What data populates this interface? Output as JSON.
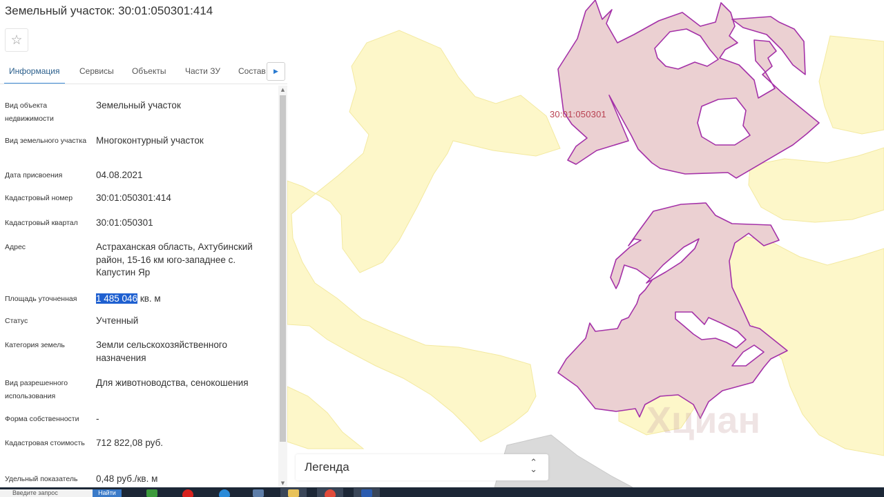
{
  "header": {
    "title": "Земельный участок: 30:01:050301:414",
    "favorite_icon": "star-outline-icon"
  },
  "tabs": [
    {
      "label": "Информация",
      "active": true
    },
    {
      "label": "Сервисы"
    },
    {
      "label": "Объекты"
    },
    {
      "label": "Части ЗУ"
    },
    {
      "label": "Состав"
    }
  ],
  "tab_next_icon": "arrow-right-icon",
  "attributes": [
    {
      "label": "Вид объекта недвижимости",
      "value": "Земельный участок"
    },
    {
      "label": "Вид земельного участка",
      "value": "Многоконтурный участок"
    },
    {
      "label": "Дата присвоения",
      "value": "04.08.2021"
    },
    {
      "label": "Кадастровый номер",
      "value": "30:01:050301:414"
    },
    {
      "label": "Кадастровый квартал",
      "value": "30:01:050301"
    },
    {
      "label": "Адрес",
      "value": "Астраханская область, Ахтубинский район, 15-16 км юго-западнее с. Капустин Яр"
    },
    {
      "label": "Площадь уточненная",
      "value_selected": "1 485 046",
      "value_rest": " кв. м"
    },
    {
      "label": "Статус",
      "value": "Учтенный"
    },
    {
      "label": "Категория земель",
      "value": "Земли сельскохозяйственного назначения"
    },
    {
      "label": "Вид разрешенного использования",
      "value": "Для животноводства, сенокошения"
    },
    {
      "label": "Форма собственности",
      "value": "-"
    },
    {
      "label": "Кадастровая стоимость",
      "value": "712 822,08 руб."
    },
    {
      "label": "Удельный показатель",
      "value": "0,48 руб./кв. м"
    }
  ],
  "map": {
    "quarter_label": "30:01:050301",
    "watermark": "Хциан",
    "legend_label": "Легенда",
    "legend_toggle_icon": "up-down-chevron-icon",
    "colors": {
      "background": "#ffffff",
      "land_zone": "#fdf7c9",
      "land_zone_edge": "#f3e9a0",
      "parcel_fill": "#ebd0d2",
      "parcel_outline": "#a431a8",
      "road": "#dadada"
    }
  },
  "taskbar": {
    "search_placeholder": "Введите запрос",
    "search_button": "Найти",
    "apps": [
      {
        "name": "network-app-icon",
        "color": "#3c9a3c"
      },
      {
        "name": "opera-icon",
        "color": "#d8221e"
      },
      {
        "name": "internet-explorer-icon",
        "color": "#2a8ad8"
      },
      {
        "name": "window-app-icon",
        "color": "#5d7da8"
      },
      {
        "name": "file-explorer-icon",
        "color": "#e8c25a"
      },
      {
        "name": "close-app-icon",
        "color": "#e04a3a"
      },
      {
        "name": "word-icon",
        "color": "#2b5cb0"
      }
    ]
  }
}
